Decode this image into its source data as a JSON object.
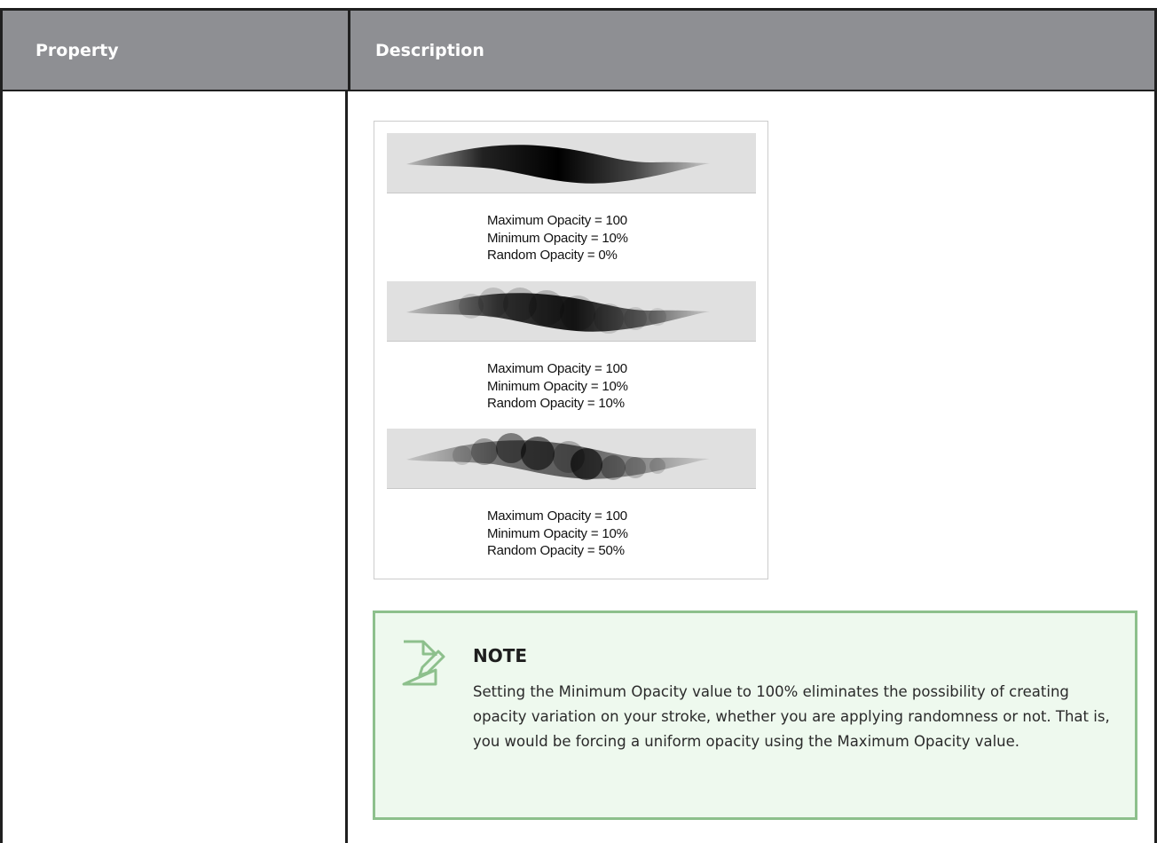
{
  "table": {
    "header": {
      "property": "Property",
      "description": "Description"
    }
  },
  "figure": {
    "examples": [
      {
        "max_line": "Maximum Opacity = 100",
        "min_line": "Minimum Opacity = 10%",
        "random_line": "Random Opacity = 0%",
        "random_opacity_percent": 0
      },
      {
        "max_line": "Maximum Opacity = 100",
        "min_line": "Minimum Opacity = 10%",
        "random_line": "Random Opacity = 10%",
        "random_opacity_percent": 10
      },
      {
        "max_line": "Maximum Opacity = 100",
        "min_line": "Minimum Opacity = 10%",
        "random_line": "Random Opacity = 50%",
        "random_opacity_percent": 50
      }
    ]
  },
  "note": {
    "icon": "note-edit-icon",
    "title": "NOTE",
    "body": "Setting the Minimum Opacity value to 100% eliminates the possibility of creating opacity variation on your stroke, whether you are applying randomness or not. That is, you would be forcing a uniform opacity using the Maximum Opacity value."
  },
  "colors": {
    "header_bg": "#8e8f93",
    "border": "#1f1f1f",
    "note_bg": "#eef9ee",
    "note_border": "#8dc08c"
  }
}
